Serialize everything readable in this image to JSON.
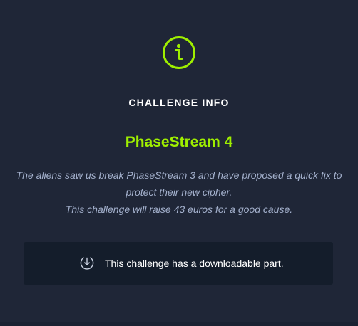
{
  "modal": {
    "icon": "info-circle-icon",
    "heading": "CHALLENGE INFO",
    "challenge_name": "PhaseStream 4",
    "description_lines": [
      "The aliens saw us break PhaseStream 3 and have proposed a quick fix to",
      "protect their new cipher.",
      "This challenge will raise 43 euros for a good cause."
    ],
    "download": {
      "icon": "download-icon",
      "label": "This challenge has a downloadable part."
    }
  },
  "colors": {
    "background": "#1f2637",
    "accent": "#9fef00",
    "text_muted": "#a4b1cd",
    "panel": "#141d2b"
  }
}
